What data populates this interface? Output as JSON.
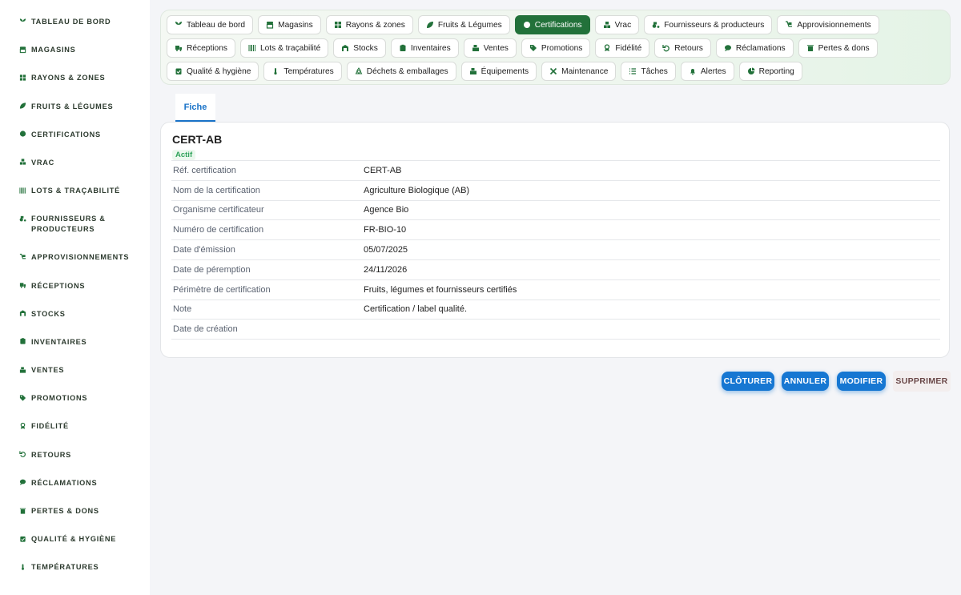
{
  "sidebar": {
    "items": [
      {
        "label": "TABLEAU DE BORD",
        "icon": "seedling-icon"
      },
      {
        "label": "MAGASINS",
        "icon": "store-icon"
      },
      {
        "label": "RAYONS & ZONES",
        "icon": "grid-icon"
      },
      {
        "label": "FRUITS & LÉGUMES",
        "icon": "leaf-icon"
      },
      {
        "label": "CERTIFICATIONS",
        "icon": "certificate-icon"
      },
      {
        "label": "VRAC",
        "icon": "boxes-icon"
      },
      {
        "label": "LOTS & TRAÇABILITÉ",
        "icon": "barcode-icon"
      },
      {
        "label": "FOURNISSEURS & PRODUCTEURS",
        "icon": "tractor-icon"
      },
      {
        "label": "APPROVISIONNEMENTS",
        "icon": "dolly-icon"
      },
      {
        "label": "RÉCEPTIONS",
        "icon": "truck-icon"
      },
      {
        "label": "STOCKS",
        "icon": "warehouse-icon"
      },
      {
        "label": "INVENTAIRES",
        "icon": "clipboard-icon"
      },
      {
        "label": "VENTES",
        "icon": "cash-register-icon"
      },
      {
        "label": "PROMOTIONS",
        "icon": "tag-icon"
      },
      {
        "label": "FIDÉLITÉ",
        "icon": "award-icon"
      },
      {
        "label": "RETOURS",
        "icon": "undo-icon"
      },
      {
        "label": "RÉCLAMATIONS",
        "icon": "comment-icon"
      },
      {
        "label": "PERTES & DONS",
        "icon": "trash-icon"
      },
      {
        "label": "QUALITÉ & HYGIÈNE",
        "icon": "clipboard-check-icon"
      },
      {
        "label": "TEMPÉRATURES",
        "icon": "thermometer-icon"
      }
    ]
  },
  "nav": {
    "chips": [
      {
        "label": "Tableau de bord",
        "icon": "seedling-icon",
        "active": false
      },
      {
        "label": "Magasins",
        "icon": "store-icon",
        "active": false
      },
      {
        "label": "Rayons & zones",
        "icon": "grid-icon",
        "active": false
      },
      {
        "label": "Fruits & Légumes",
        "icon": "leaf-icon",
        "active": false
      },
      {
        "label": "Certifications",
        "icon": "certificate-icon",
        "active": true
      },
      {
        "label": "Vrac",
        "icon": "boxes-icon",
        "active": false
      },
      {
        "label": "Fournisseurs & producteurs",
        "icon": "tractor-icon",
        "active": false
      },
      {
        "label": "Approvisionnements",
        "icon": "dolly-icon",
        "active": false
      },
      {
        "label": "Réceptions",
        "icon": "truck-icon",
        "active": false
      },
      {
        "label": "Lots & traçabilité",
        "icon": "barcode-icon",
        "active": false
      },
      {
        "label": "Stocks",
        "icon": "warehouse-icon",
        "active": false
      },
      {
        "label": "Inventaires",
        "icon": "clipboard-icon",
        "active": false
      },
      {
        "label": "Ventes",
        "icon": "cash-register-icon",
        "active": false
      },
      {
        "label": "Promotions",
        "icon": "tag-icon",
        "active": false
      },
      {
        "label": "Fidélité",
        "icon": "award-icon",
        "active": false
      },
      {
        "label": "Retours",
        "icon": "undo-icon",
        "active": false
      },
      {
        "label": "Réclamations",
        "icon": "comment-icon",
        "active": false
      },
      {
        "label": "Pertes & dons",
        "icon": "trash-icon",
        "active": false
      },
      {
        "label": "Qualité & hygiène",
        "icon": "clipboard-check-icon",
        "active": false
      },
      {
        "label": "Températures",
        "icon": "thermometer-icon",
        "active": false
      },
      {
        "label": "Déchets & emballages",
        "icon": "recycle-icon",
        "active": false
      },
      {
        "label": "Équipements",
        "icon": "cash-register-icon",
        "active": false
      },
      {
        "label": "Maintenance",
        "icon": "tools-icon",
        "active": false
      },
      {
        "label": "Tâches",
        "icon": "tasks-icon",
        "active": false
      },
      {
        "label": "Alertes",
        "icon": "bell-icon",
        "active": false
      },
      {
        "label": "Reporting",
        "icon": "pie-chart-icon",
        "active": false
      }
    ]
  },
  "tabs": {
    "fiche": "Fiche"
  },
  "record": {
    "title": "CERT-AB",
    "status": "Actif",
    "fields": [
      {
        "key": "Réf. certification",
        "value": "CERT-AB"
      },
      {
        "key": "Nom de la certification",
        "value": "Agriculture Biologique (AB)"
      },
      {
        "key": "Organisme certificateur",
        "value": "Agence Bio"
      },
      {
        "key": "Numéro de certification",
        "value": "FR-BIO-10"
      },
      {
        "key": "Date d'émission",
        "value": "05/07/2025"
      },
      {
        "key": "Date de péremption",
        "value": "24/11/2026"
      },
      {
        "key": "Périmètre de certification",
        "value": "Fruits, légumes et fournisseurs certifiés"
      },
      {
        "key": "Note",
        "value": "Certification / label qualité."
      },
      {
        "key": "Date de création",
        "value": ""
      }
    ]
  },
  "actions": {
    "close": "CLÔTURER",
    "cancel": "ANNULER",
    "edit": "MODIFIER",
    "delete": "SUPPRIMER"
  },
  "colors": {
    "accent_green": "#22713a",
    "accent_blue": "#1677d2",
    "status_green": "#2fa35a"
  }
}
